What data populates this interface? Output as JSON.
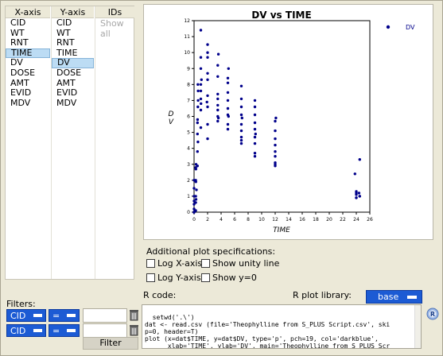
{
  "columns": {
    "x_header": "X-axis",
    "y_header": "Y-axis",
    "ids_header": "IDs",
    "ids_show_all": "Show all",
    "x_items": [
      "CID",
      "WT",
      "RNT",
      "TIME",
      "DV",
      "DOSE",
      "AMT",
      "EVID",
      "MDV"
    ],
    "x_selected": 3,
    "y_items": [
      "CID",
      "WT",
      "RNT",
      "TIME",
      "DV",
      "DOSE",
      "AMT",
      "EVID",
      "MDV"
    ],
    "y_selected": 4
  },
  "chart_data": {
    "type": "scatter",
    "title": "DV vs TIME",
    "xlabel": "TIME",
    "ylabel": "DV",
    "xlim": [
      0,
      26
    ],
    "ylim": [
      0,
      12
    ],
    "xticks": [
      0,
      2,
      4,
      6,
      8,
      10,
      12,
      14,
      16,
      18,
      20,
      22,
      24,
      26
    ],
    "yticks": [
      0,
      1,
      2,
      3,
      4,
      5,
      6,
      7,
      8,
      9,
      10,
      11,
      12
    ],
    "legend_label": "DV",
    "legend_position": "top-right",
    "color": "#00008b",
    "points": [
      [
        0,
        0.7
      ],
      [
        0,
        0.2
      ],
      [
        0,
        1.0
      ],
      [
        0,
        0
      ],
      [
        0,
        2.0
      ],
      [
        0,
        1.5
      ],
      [
        0,
        0.5
      ],
      [
        0,
        0
      ],
      [
        0,
        0
      ],
      [
        0,
        0
      ],
      [
        0.25,
        0.6
      ],
      [
        0.25,
        1.0
      ],
      [
        0.27,
        1.9
      ],
      [
        0.27,
        2.7
      ],
      [
        0.25,
        2.8
      ],
      [
        0.3,
        3.0
      ],
      [
        0.3,
        0.8
      ],
      [
        0.35,
        1.4
      ],
      [
        0.25,
        0.1
      ],
      [
        0.25,
        2.0
      ],
      [
        0.5,
        3.8
      ],
      [
        0.5,
        4.9
      ],
      [
        0.5,
        5.6
      ],
      [
        0.52,
        5.8
      ],
      [
        0.57,
        6.6
      ],
      [
        0.6,
        7.0
      ],
      [
        0.6,
        7.6
      ],
      [
        0.57,
        8.0
      ],
      [
        0.58,
        4.4
      ],
      [
        0.5,
        2.9
      ],
      [
        1,
        5.3
      ],
      [
        1,
        6.4
      ],
      [
        1,
        7.1
      ],
      [
        1,
        7.6
      ],
      [
        1,
        8.0
      ],
      [
        1,
        9.0
      ],
      [
        1,
        9.7
      ],
      [
        1,
        11.4
      ],
      [
        1.1,
        8.3
      ],
      [
        1.02,
        6.8
      ],
      [
        2,
        4.6
      ],
      [
        2,
        5.5
      ],
      [
        2,
        6.6
      ],
      [
        2,
        7.3
      ],
      [
        2,
        8.3
      ],
      [
        2,
        8.7
      ],
      [
        2,
        9.7
      ],
      [
        2,
        10.0
      ],
      [
        2,
        10.5
      ],
      [
        1.9,
        6.9
      ],
      [
        3.5,
        5.7
      ],
      [
        3.5,
        6.0
      ],
      [
        3.5,
        6.7
      ],
      [
        3.5,
        7.4
      ],
      [
        3.5,
        8.5
      ],
      [
        3.5,
        9.2
      ],
      [
        3.6,
        9.9
      ],
      [
        3.5,
        6.4
      ],
      [
        3.5,
        7.1
      ],
      [
        3.6,
        5.9
      ],
      [
        5,
        5.5
      ],
      [
        5,
        6.1
      ],
      [
        5,
        6.5
      ],
      [
        5,
        7.0
      ],
      [
        5,
        7.5
      ],
      [
        5,
        8.1
      ],
      [
        5,
        8.4
      ],
      [
        5.1,
        9.0
      ],
      [
        5,
        5.2
      ],
      [
        5.1,
        6.0
      ],
      [
        7,
        4.3
      ],
      [
        7,
        4.7
      ],
      [
        7,
        5.1
      ],
      [
        7,
        5.5
      ],
      [
        7,
        6.1
      ],
      [
        7,
        6.6
      ],
      [
        7,
        7.1
      ],
      [
        7,
        7.9
      ],
      [
        7.1,
        5.9
      ],
      [
        7,
        4.5
      ],
      [
        9,
        3.5
      ],
      [
        9,
        3.7
      ],
      [
        9,
        4.3
      ],
      [
        9,
        4.7
      ],
      [
        9,
        5.2
      ],
      [
        9,
        5.6
      ],
      [
        9,
        6.1
      ],
      [
        9,
        6.6
      ],
      [
        9.1,
        4.9
      ],
      [
        9,
        7.0
      ],
      [
        12,
        2.9
      ],
      [
        12,
        3.1
      ],
      [
        12,
        3.5
      ],
      [
        12,
        3.8
      ],
      [
        12,
        4.2
      ],
      [
        12,
        4.6
      ],
      [
        12,
        5.1
      ],
      [
        12,
        5.7
      ],
      [
        12.1,
        5.9
      ],
      [
        12,
        3.0
      ],
      [
        24,
        0.9
      ],
      [
        24,
        1.1
      ],
      [
        24,
        1.2
      ],
      [
        24,
        1.3
      ],
      [
        24.5,
        1.0
      ],
      [
        24.4,
        1.2
      ],
      [
        23.8,
        2.4
      ],
      [
        24.5,
        3.3
      ],
      [
        24.5,
        1.0
      ],
      [
        24,
        0.9
      ]
    ]
  },
  "specs": {
    "title": "Additional plot specifications:",
    "log_x": "Log X-axis",
    "show_unity": "Show unity line",
    "log_y": "Log Y-axis",
    "show_y0": "Show y=0"
  },
  "filters": {
    "label": "Filters:",
    "rows": [
      {
        "variable": "CID",
        "operator": "=",
        "value": ""
      },
      {
        "variable": "CID",
        "operator": "=",
        "value": ""
      }
    ],
    "button": "Filter"
  },
  "rcode": {
    "label": "R code:",
    "library_label": "R plot library:",
    "library_value": "base",
    "code": "setwd('.\\')\ndat <- read.csv (file='Theophylline from S_PLUS Script.csv', ski\np=0, header=T)\nplot (x=dat$TIME, y=dat$DV, type='p', pch=19, col='darkblue',\n      xlab='TIME', ylab='DV', main='Theophylline from S_PLUS Scr"
  },
  "colors": {
    "accent": "#1c5bd4",
    "selection": "#bcdcf4",
    "points": "#00008b",
    "background": "#ece9d8"
  }
}
